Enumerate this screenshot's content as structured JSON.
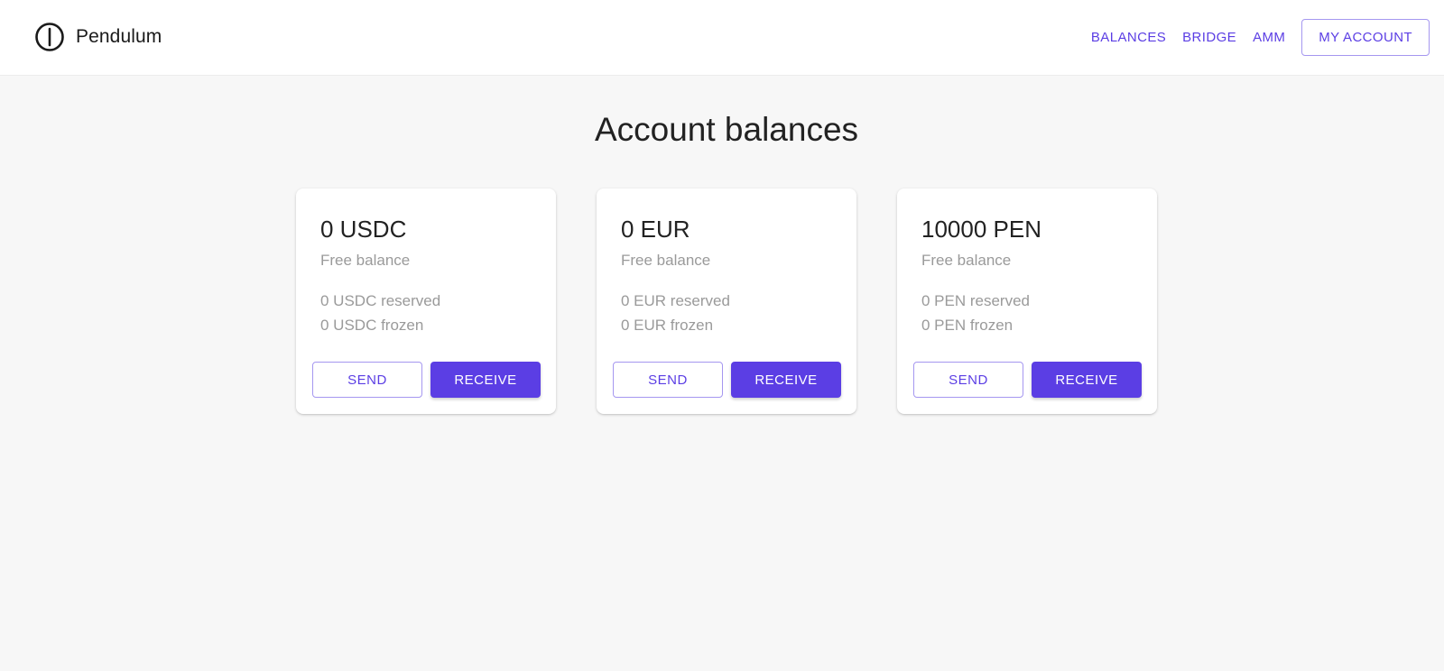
{
  "header": {
    "brand_name": "Pendulum",
    "logo_icon": "pendulum-logo-icon",
    "nav": {
      "balances": "BALANCES",
      "bridge": "BRIDGE",
      "amm": "AMM",
      "account": "MY ACCOUNT"
    }
  },
  "main": {
    "title": "Account balances",
    "cards": [
      {
        "amount": "0 USDC",
        "free_label": "Free balance",
        "reserved": "0 USDC reserved",
        "frozen": "0 USDC frozen",
        "send_label": "SEND",
        "receive_label": "RECEIVE"
      },
      {
        "amount": "0 EUR",
        "free_label": "Free balance",
        "reserved": "0 EUR reserved",
        "frozen": "0 EUR frozen",
        "send_label": "SEND",
        "receive_label": "RECEIVE"
      },
      {
        "amount": "10000 PEN",
        "free_label": "Free balance",
        "reserved": "0 PEN reserved",
        "frozen": "0 PEN frozen",
        "send_label": "SEND",
        "receive_label": "RECEIVE"
      }
    ]
  },
  "colors": {
    "accent": "#5b3ee4",
    "background": "#f7f7f7",
    "card": "#ffffff",
    "muted_text": "#9a9a9a"
  }
}
